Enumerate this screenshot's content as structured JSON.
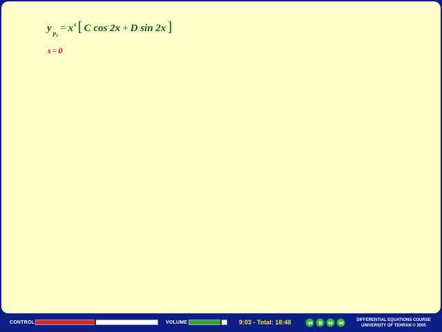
{
  "formula": {
    "y": "y",
    "sub_p": "p",
    "sub_2": "2",
    "equals": "=",
    "x": "x",
    "exp_s": "s",
    "lbracket": "[",
    "term1": "C cos 2x",
    "plus": "+",
    "term2": "D sin 2x",
    "rbracket": "]"
  },
  "s_line": {
    "s": "s",
    "equals": "=",
    "zero": "0"
  },
  "controls": {
    "control_label": "CONTROL",
    "control_progress": 0.49,
    "volume_label": "VOLUME",
    "volume_level": 0.85,
    "time_text": "9:03 - Total: 18:48",
    "buttons": [
      "rewind-icon",
      "pause-icon",
      "forward-icon",
      "next-icon"
    ]
  },
  "course": {
    "line1": "DIFFERENTIAL EQUATIONS COURSE",
    "line2": "UNIVERSITY OF TEHRAN © 2005"
  },
  "colors": {
    "background": "#ffffcc",
    "frame": "#0b1f86",
    "formula": "#0b5d1e",
    "s_line": "#e0002a",
    "control_fill": "#d9262e",
    "volume_fill": "#2fa832",
    "time": "#ffe23a"
  }
}
